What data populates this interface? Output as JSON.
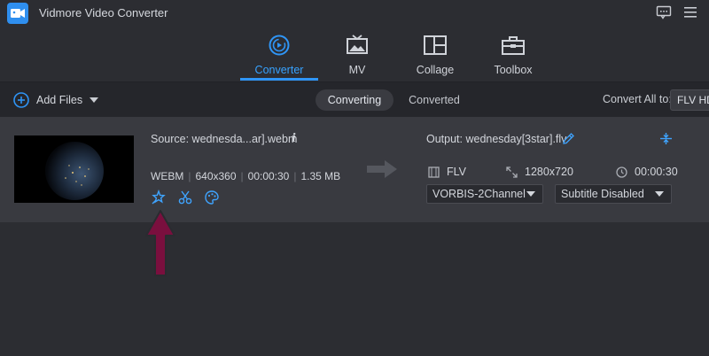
{
  "app": {
    "title": "Vidmore Video Converter"
  },
  "nav": {
    "tabs": [
      {
        "label": "Converter",
        "icon": "converter-icon",
        "active": true
      },
      {
        "label": "MV",
        "icon": "mv-icon",
        "active": false
      },
      {
        "label": "Collage",
        "icon": "collage-icon",
        "active": false
      },
      {
        "label": "Toolbox",
        "icon": "toolbox-icon",
        "active": false
      }
    ]
  },
  "toolbar": {
    "add_files_label": "Add Files",
    "segments": [
      "Converting",
      "Converted"
    ],
    "convert_all_label": "Convert All to:",
    "convert_all_format": "FLV HD"
  },
  "file": {
    "source_label": "Source: wednesda...ar].webm",
    "meta": [
      "WEBM",
      "640x360",
      "00:00:30",
      "1.35 MB"
    ],
    "output_label": "Output: wednesday[3star].flv",
    "output_format": "FLV",
    "output_resolution": "1280x720",
    "output_duration": "00:00:30",
    "audio_track": "VORBIS-2Channel",
    "subtitle": "Subtitle Disabled"
  },
  "colors": {
    "accent": "#2f95f6",
    "background": "#2c2d32",
    "row": "#393a40",
    "annotation": "#7a0f3e"
  }
}
